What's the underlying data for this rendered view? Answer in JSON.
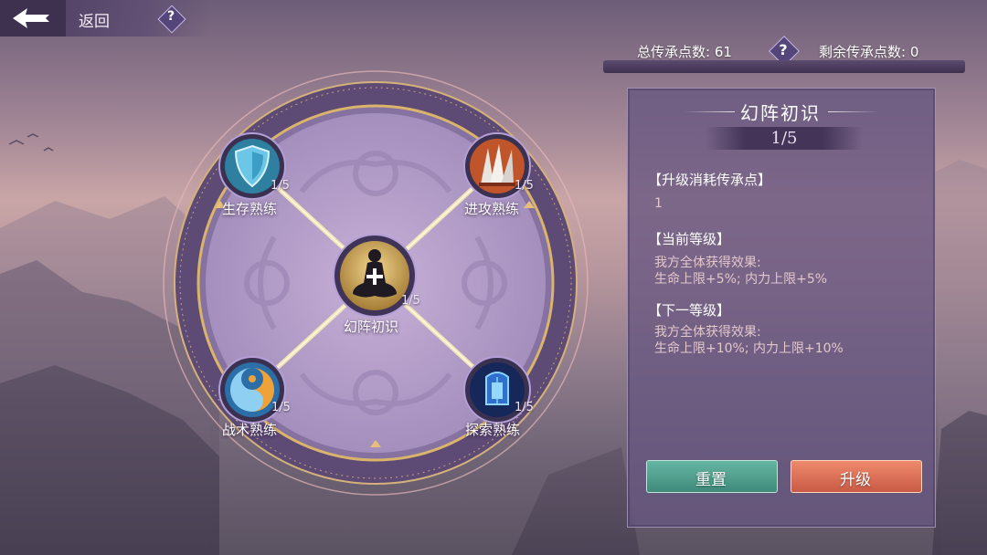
{
  "header": {
    "back_label": "返回",
    "help_icon": "question-icon"
  },
  "points": {
    "total_label": "总传承点数: 61",
    "remaining_label": "剩余传承点数: 0"
  },
  "colors": {
    "accent_gold": "#d9b46a",
    "reset_button": "#4e9e8e",
    "upgrade_button": "#d9735a",
    "panel": "#665680"
  },
  "center_node": {
    "name": "幻阵初识",
    "count": "1/5",
    "icon": "meditation-icon"
  },
  "nodes": [
    {
      "name": "生存熟练",
      "count": "1/5",
      "icon": "shield-icon"
    },
    {
      "name": "进攻熟练",
      "count": "1/5",
      "icon": "blades-icon"
    },
    {
      "name": "战术熟练",
      "count": "1/5",
      "icon": "yin-yang-icon"
    },
    {
      "name": "探索熟练",
      "count": "1/5",
      "icon": "lantern-icon"
    }
  ],
  "detail": {
    "title": "幻阵初识",
    "level": "1/5",
    "cost_title": "【升级消耗传承点】",
    "cost_value": "1",
    "current_title": "【当前等级】",
    "current_line1": "我方全体获得效果:",
    "current_line2": "生命上限+5%; 内力上限+5%",
    "next_title": "【下一等级】",
    "next_line1": "我方全体获得效果:",
    "next_line2": "生命上限+10%; 内力上限+10%"
  },
  "buttons": {
    "reset_label": "重置",
    "upgrade_label": "升级"
  }
}
